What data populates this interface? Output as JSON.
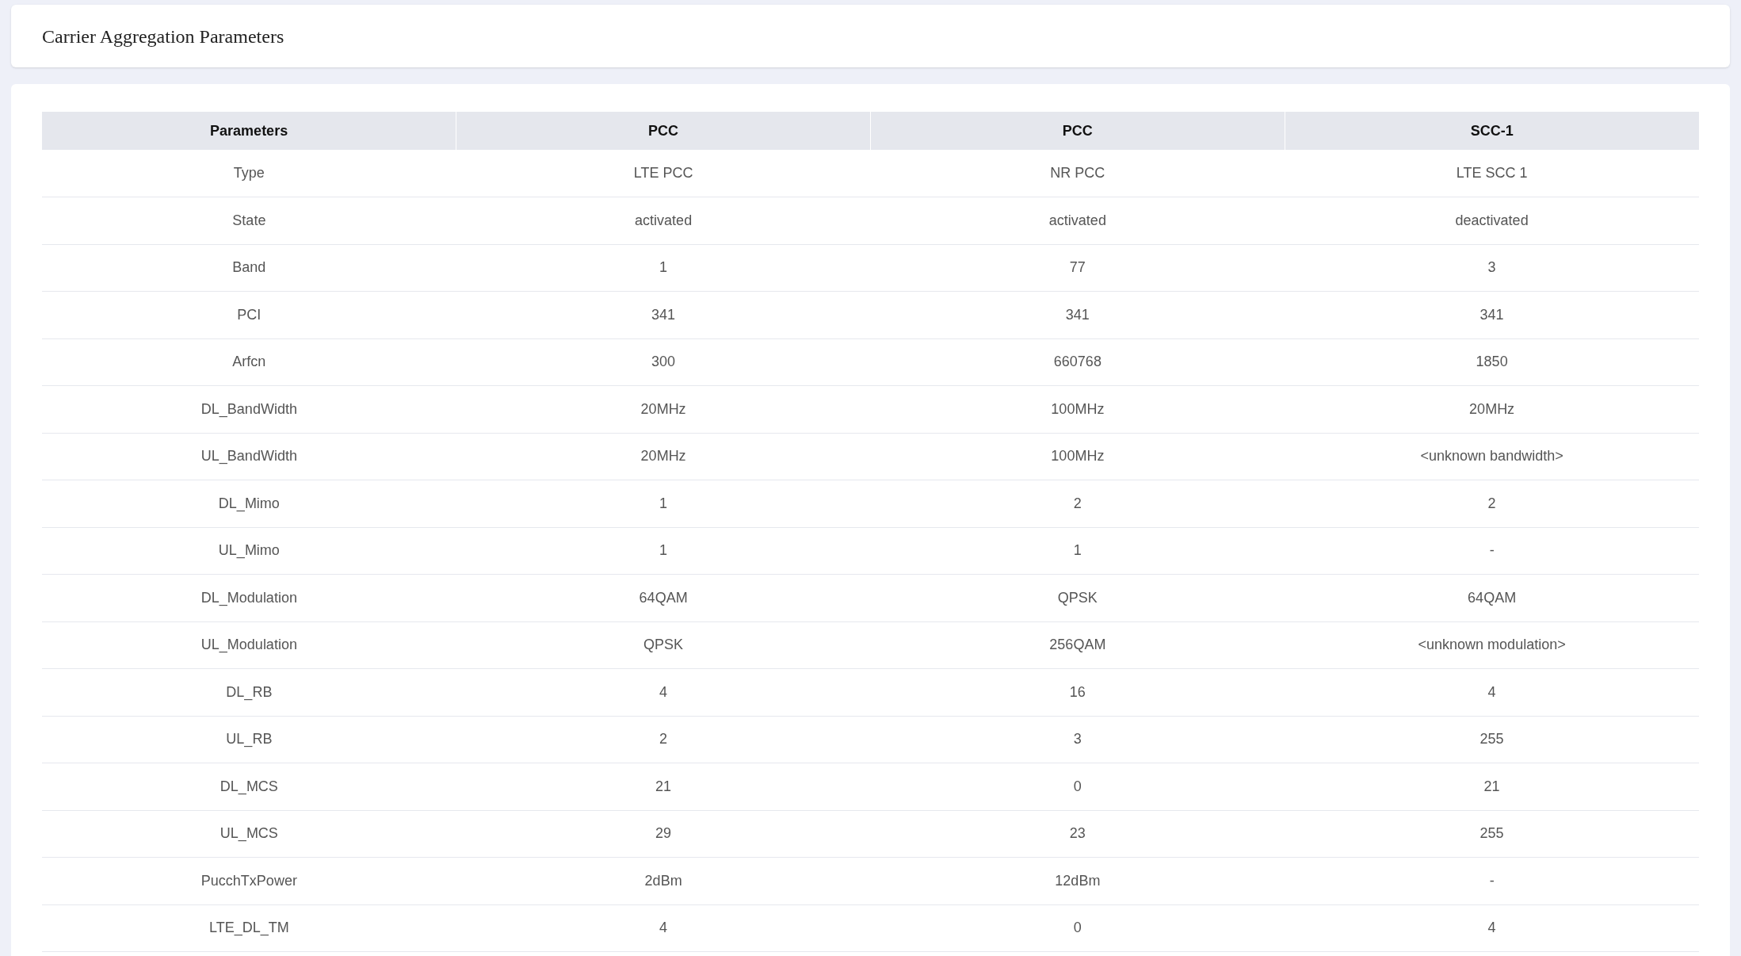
{
  "header": {
    "title": "Carrier Aggregation Parameters"
  },
  "table": {
    "columns": [
      "Parameters",
      "PCC",
      "PCC",
      "SCC-1"
    ],
    "rows": [
      [
        "Type",
        "LTE PCC",
        "NR PCC",
        "LTE SCC 1"
      ],
      [
        "State",
        "activated",
        "activated",
        "deactivated"
      ],
      [
        "Band",
        "1",
        "77",
        "3"
      ],
      [
        "PCI",
        "341",
        "341",
        "341"
      ],
      [
        "Arfcn",
        "300",
        "660768",
        "1850"
      ],
      [
        "DL_BandWidth",
        "20MHz",
        "100MHz",
        "20MHz"
      ],
      [
        "UL_BandWidth",
        "20MHz",
        "100MHz",
        "<unknown bandwidth>"
      ],
      [
        "DL_Mimo",
        "1",
        "2",
        "2"
      ],
      [
        "UL_Mimo",
        "1",
        "1",
        "-"
      ],
      [
        "DL_Modulation",
        "64QAM",
        "QPSK",
        "64QAM"
      ],
      [
        "UL_Modulation",
        "QPSK",
        "256QAM",
        "<unknown modulation>"
      ],
      [
        "DL_RB",
        "4",
        "16",
        "4"
      ],
      [
        "UL_RB",
        "2",
        "3",
        "255"
      ],
      [
        "DL_MCS",
        "21",
        "0",
        "21"
      ],
      [
        "UL_MCS",
        "29",
        "23",
        "255"
      ],
      [
        "PucchTxPower",
        "2dBm",
        "12dBm",
        "-"
      ],
      [
        "LTE_DL_TM",
        "4",
        "0",
        "4"
      ]
    ]
  }
}
